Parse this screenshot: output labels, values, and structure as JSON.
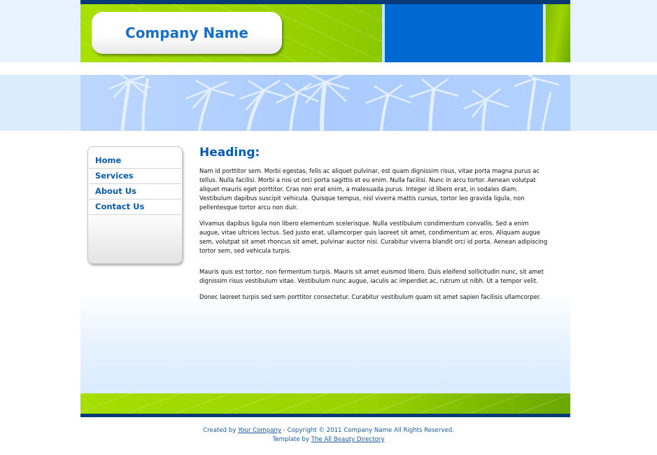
{
  "header": {
    "company_name": "Company Name"
  },
  "nav": [
    {
      "label": "Home"
    },
    {
      "label": "Services"
    },
    {
      "label": "About Us"
    },
    {
      "label": "Contact Us"
    }
  ],
  "main": {
    "heading": "Heading:",
    "paragraphs": [
      "Nam id porttitor sem. Morbi egestas, felis ac aliquet pulvinar, est quam dignissim risus, vitae porta magna purus ac tellus. Nulla facilisi. Morbi a nisi ut orci porta sagittis et eu enim. Nulla facilisi. Nunc in arcu tortor. Aenean volutpat aliquet mauris eget porttitor. Cras non erat enim, a malesuada purus. Integer id libero erat, in sodales diam. Vestibulum dapibus suscipit vehicula. Quisque tempus, nisl viverra mattis cursus, tortor leo gravida ligula, non pellentesque tortor arcu non duir.",
      "Vivamus dapibus ligula non libero elementum scelerisque. Nulla vestibulum condimentum convallis. Sed a enim augue, vitae ultrices lectus. Sed justo erat, ullamcorper quis laoreet sit amet, condimentum ac eros. Aliquam augue sem, volutpat sit amet rhoncus sit amet, pulvinar auctor nisi. Curabitur viverra blandit orci id porta. Aenean adipiscing tortor sem, sed vehicula turpis.",
      "Mauris quis est tortor, non fermentum turpis. Mauris sit amet euismod libero. Duis eleifend sollicitudin nunc, sit amet dignissim risus vestibulum vitae. Vestibulum nunc augue, iaculis ac imperdiet ac, rutrum ut nibh. Ut a tempor velit.",
      "Donec laoreet turpis sed sem porttitor consectetur. Curabitur vestibulum quam sit amet sapien facilisis ullamcorper."
    ]
  },
  "footer": {
    "created_prefix": "Created by ",
    "created_link": "Your Company",
    "copyright": " - Copyright © 2011 Company Name All Rights Reserved.",
    "template_prefix": "Template by ",
    "template_link": "The All Beauty Directory"
  },
  "colors": {
    "accent_blue": "#0068d1",
    "link_blue": "#0a5cb0",
    "green": "#9ad400",
    "navy": "#0a3a75"
  }
}
